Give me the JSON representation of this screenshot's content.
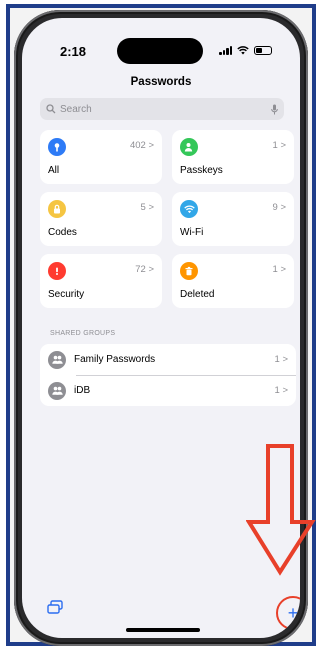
{
  "status_bar": {
    "time": "2:18"
  },
  "header": {
    "title": "Passwords"
  },
  "search": {
    "placeholder": "Search"
  },
  "tiles": [
    {
      "label": "All",
      "count": "402 >",
      "color": "#2e7bf6",
      "icon": "key-icon"
    },
    {
      "label": "Passkeys",
      "count": "1 >",
      "color": "#34c759",
      "icon": "person-icon"
    },
    {
      "label": "Codes",
      "count": "5 >",
      "color": "#f5c542",
      "icon": "lock-icon"
    },
    {
      "label": "Wi-Fi",
      "count": "9 >",
      "color": "#32a7e8",
      "icon": "wifi-icon"
    },
    {
      "label": "Security",
      "count": "72 >",
      "color": "#ff3b30",
      "icon": "exclamation-icon"
    },
    {
      "label": "Deleted",
      "count": "1 >",
      "color": "#ff9500",
      "icon": "trash-icon"
    }
  ],
  "shared_groups": {
    "header": "SHARED GROUPS",
    "items": [
      {
        "label": "Family Passwords",
        "count": "1 >"
      },
      {
        "label": "iDB",
        "count": "1 >"
      }
    ]
  },
  "toolbar": {
    "add_label": "+"
  },
  "annotation": {
    "color": "#e8402a"
  }
}
